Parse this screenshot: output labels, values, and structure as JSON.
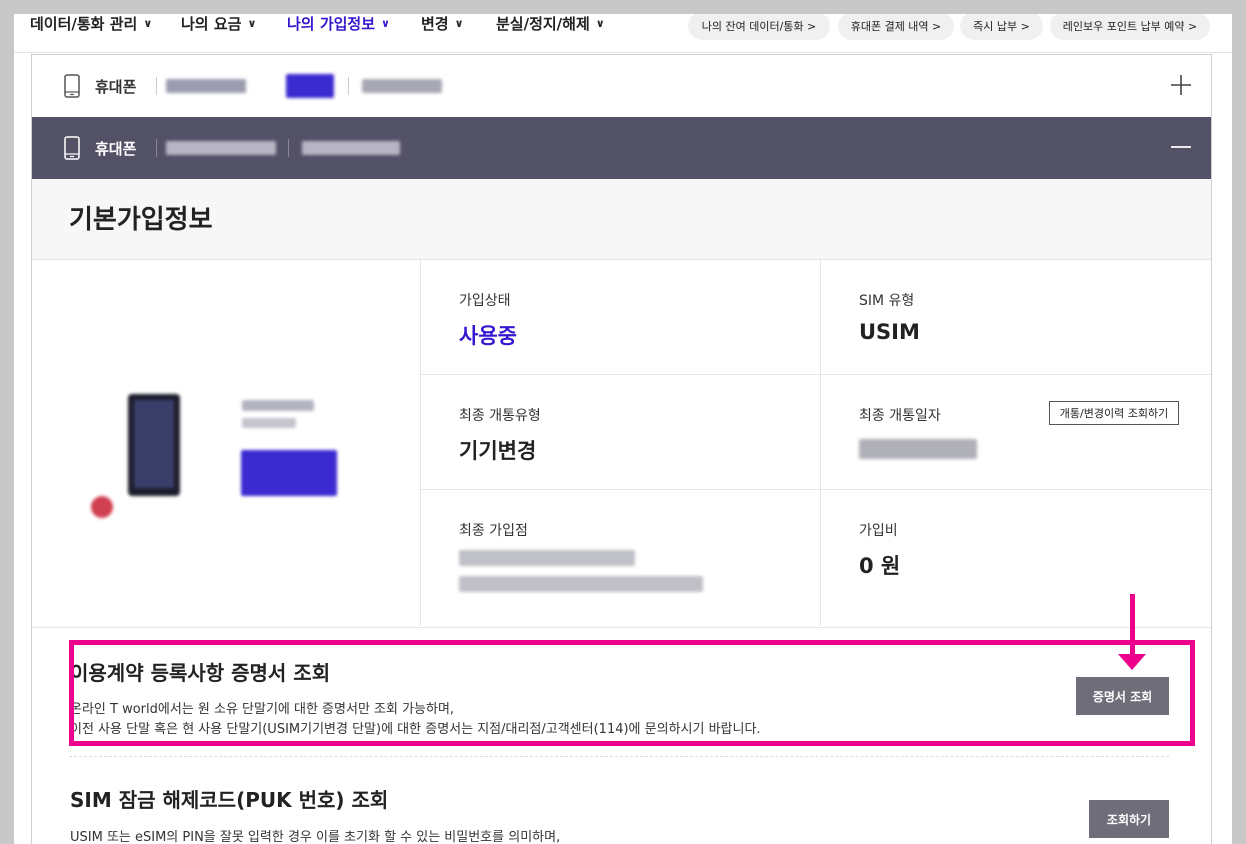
{
  "nav": {
    "items": [
      {
        "label": "데이터/통화 관리",
        "active": false
      },
      {
        "label": "나의 요금",
        "active": false
      },
      {
        "label": "나의 가입정보",
        "active": true
      },
      {
        "label": "변경",
        "active": false
      },
      {
        "label": "분실/정지/해제",
        "active": false
      }
    ],
    "shortcuts": [
      "나의 잔여 데이터/통화 >",
      "휴대폰 결제 내역 >",
      "즉시 납부 >",
      "레인보우 포인트 납부 예약 >"
    ],
    "chevron_icon": "chevron-down-icon"
  },
  "lines": [
    {
      "label": "휴대폰",
      "state": "collapsed",
      "icon": "plus-icon"
    },
    {
      "label": "휴대폰",
      "state": "expanded",
      "icon": "minus-icon"
    }
  ],
  "basic_info": {
    "title": "기본가입정보",
    "cells": [
      {
        "label": "가입상태",
        "value": "사용중"
      },
      {
        "label": "SIM 유형",
        "value": "USIM"
      },
      {
        "label": "최종 개통유형",
        "value": "기기변경"
      },
      {
        "label": "최종 개통일자",
        "value": "",
        "button": "개통/변경이력 조회하기"
      },
      {
        "label": "최종 가입점",
        "value": ""
      },
      {
        "label": "가입비",
        "value": "0 원"
      }
    ]
  },
  "certificate": {
    "title": "이용계약 등록사항 증명서 조회",
    "desc_line1": "온라인 T world에서는 원 소유 단말기에 대한 증명서만 조회 가능하며,",
    "desc_line2": "이전 사용 단말 혹은 현 사용 단말기(USIM기기변경 단말)에 대한 증명서는 지점/대리점/고객센터(114)에 문의하시기 바랍니다.",
    "button": "증명서 조회"
  },
  "puk": {
    "title": "SIM 잠금 해제코드(PUK 번호) 조회",
    "desc": "USIM 또는 eSIM의 PIN을 잘못 입력한 경우 이를 초기화 할 수 있는 비밀번호를 의미하며,",
    "button": "조회하기"
  },
  "colors": {
    "accent": "#3617ce",
    "header_dark": "#535166",
    "highlight": "#ec008c",
    "button_gray": "#6f6d7a"
  }
}
